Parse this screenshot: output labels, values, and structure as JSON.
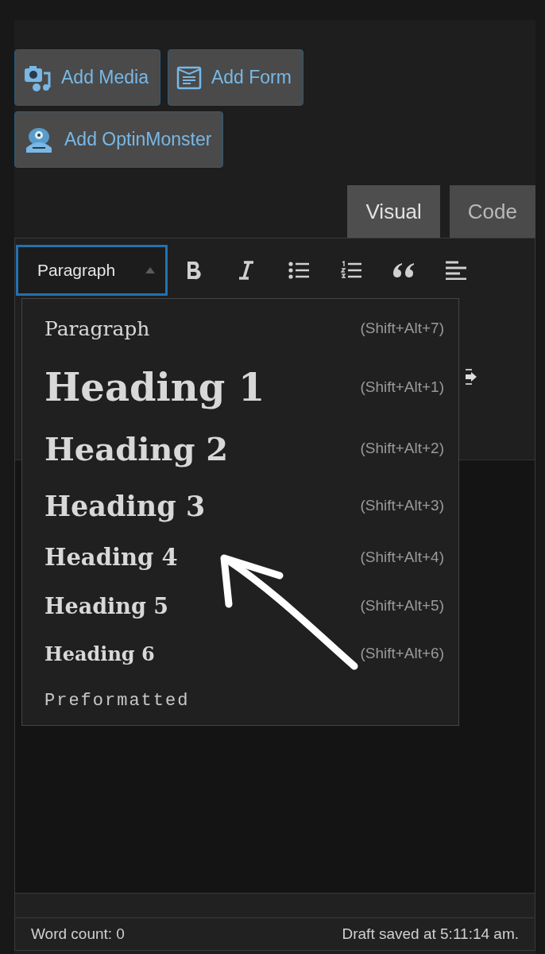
{
  "media_buttons": [
    {
      "label": "Add Media",
      "kind": "media"
    },
    {
      "label": "Add Form",
      "kind": "form"
    },
    {
      "label": "Add OptinMonster",
      "kind": "monster"
    }
  ],
  "tabs": [
    {
      "label": "Visual",
      "selected": true
    },
    {
      "label": "Code",
      "selected": false
    }
  ],
  "format_select": {
    "value": "Paragraph",
    "expanded": true
  },
  "format_menu": [
    {
      "label": "Paragraph",
      "kind": "paragraph",
      "shortcut": "(Shift+Alt+7)"
    },
    {
      "label": "Heading 1",
      "kind": "h1",
      "shortcut": "(Shift+Alt+1)"
    },
    {
      "label": "Heading 2",
      "kind": "h2",
      "shortcut": "(Shift+Alt+2)"
    },
    {
      "label": "Heading 3",
      "kind": "h3",
      "shortcut": "(Shift+Alt+3)"
    },
    {
      "label": "Heading 4",
      "kind": "h4",
      "shortcut": "(Shift+Alt+4)"
    },
    {
      "label": "Heading 5",
      "kind": "h5",
      "shortcut": "(Shift+Alt+5)"
    },
    {
      "label": "Heading 6",
      "kind": "h6",
      "shortcut": "(Shift+Alt+6)"
    },
    {
      "label": "Preformatted",
      "kind": "pre"
    }
  ],
  "status_bar": {
    "word_count": "Word count: 0",
    "draft_status": "Draft saved at 5:11:14 am."
  }
}
